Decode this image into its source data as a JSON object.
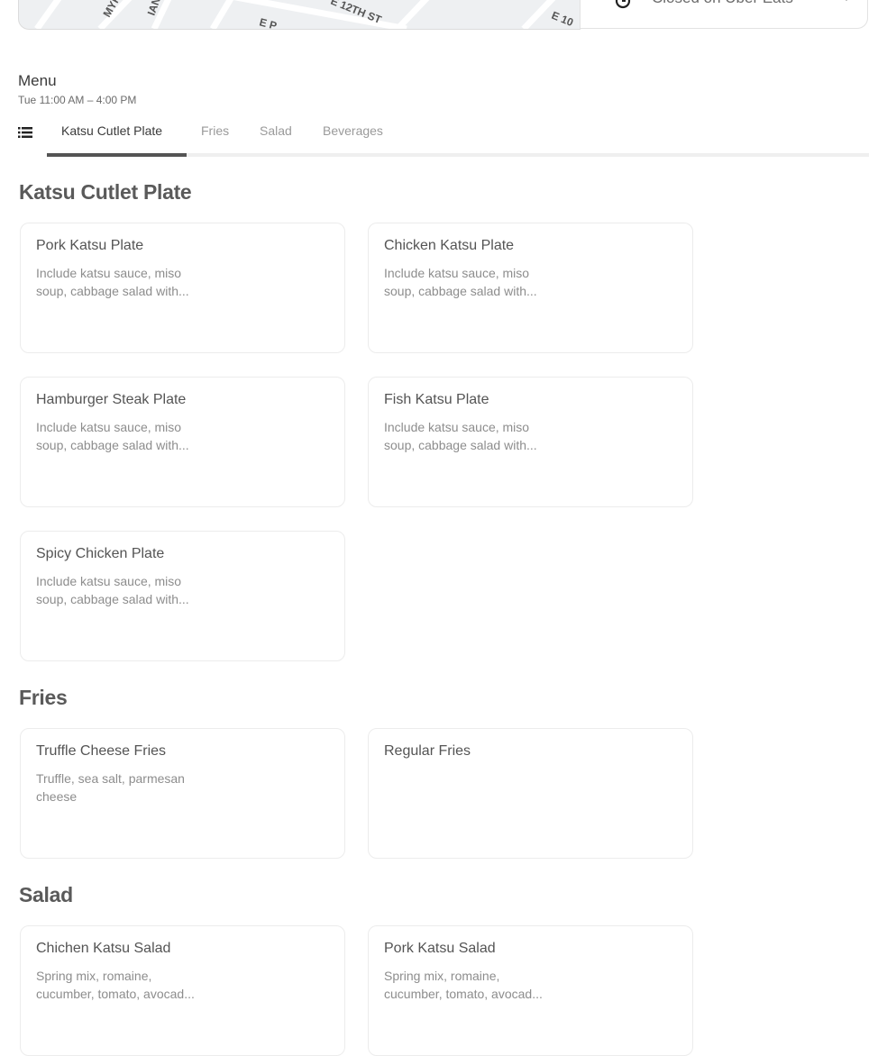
{
  "map": {
    "street_labels": [
      "MYR",
      "IAN S",
      "E 12TH ST",
      "E 10",
      "E P"
    ]
  },
  "status": {
    "text": "Closed on Uber Eats",
    "icon": "clock-icon",
    "dropdown_icon": "chevron-down-icon"
  },
  "menu": {
    "title": "Menu",
    "hours": "Tue 11:00 AM – 4:00 PM"
  },
  "tabs": [
    {
      "label": "Katsu Cutlet Plate",
      "active": true
    },
    {
      "label": "Fries",
      "active": false
    },
    {
      "label": "Salad",
      "active": false
    },
    {
      "label": "Beverages",
      "active": false
    }
  ],
  "sections": [
    {
      "title": "Katsu Cutlet Plate",
      "items": [
        {
          "name": "Pork Katsu Plate",
          "description": "Include katsu sauce, miso soup, cabbage salad with..."
        },
        {
          "name": "Chicken Katsu Plate",
          "description": "Include katsu sauce, miso soup, cabbage salad with..."
        },
        {
          "name": "Hamburger Steak Plate",
          "description": "Include katsu sauce, miso soup, cabbage salad with..."
        },
        {
          "name": "Fish Katsu Plate",
          "description": "Include katsu sauce, miso soup, cabbage salad with..."
        },
        {
          "name": "Spicy Chicken Plate",
          "description": "Include katsu sauce, miso soup, cabbage salad with..."
        }
      ]
    },
    {
      "title": "Fries",
      "items": [
        {
          "name": "Truffle Cheese Fries",
          "description": "Truffle, sea salt, parmesan cheese"
        },
        {
          "name": "Regular Fries",
          "description": ""
        }
      ]
    },
    {
      "title": "Salad",
      "items": [
        {
          "name": "Chichen Katsu Salad",
          "description": "Spring mix, romaine, cucumber, tomato, avocad..."
        },
        {
          "name": "Pork Katsu Salad",
          "description": "Spring mix, romaine, cucumber, tomato, avocad..."
        }
      ]
    }
  ]
}
